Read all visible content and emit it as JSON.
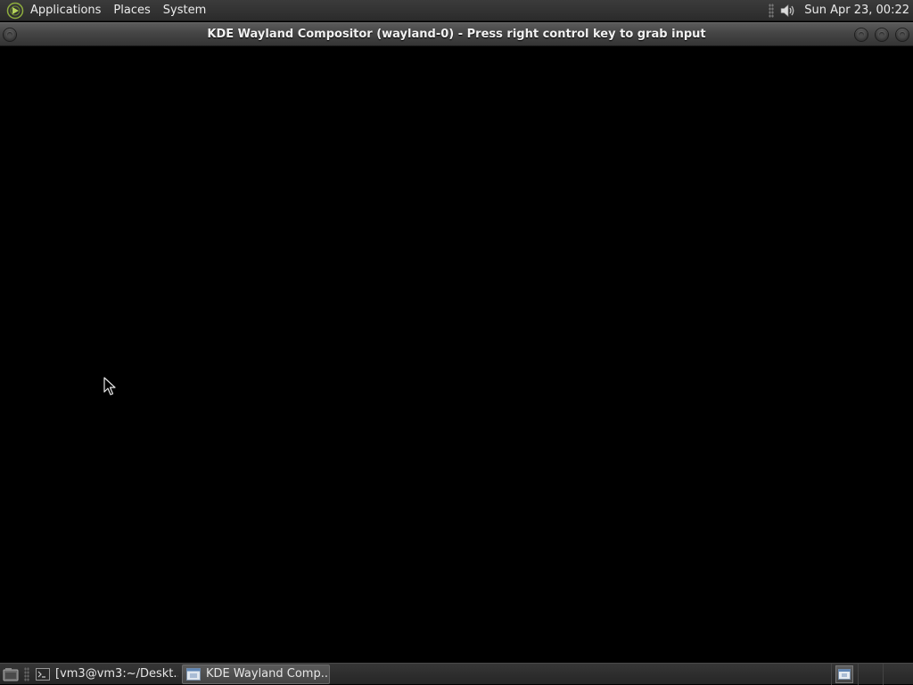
{
  "top_panel": {
    "menus": [
      "Applications",
      "Places",
      "System"
    ],
    "clock": "Sun Apr 23, 00:22",
    "icons": {
      "logo": "distro-logo-icon",
      "volume": "speaker-icon"
    }
  },
  "window": {
    "title": "KDE Wayland Compositor (wayland-0) - Press right control key to grab input",
    "icons": {
      "menu": "window-menu-icon",
      "minimize": "minimize-icon",
      "maximize": "maximize-icon",
      "close": "close-icon"
    }
  },
  "taskbar": {
    "tasks": [
      {
        "label": "[vm3@vm3:~/Deskt...",
        "icon": "terminal-icon",
        "active": false
      },
      {
        "label": "KDE Wayland Comp...",
        "icon": "window-icon",
        "active": true
      }
    ],
    "icons": {
      "show_desktop": "show-desktop-icon",
      "tray": "workspace-switcher-icon"
    }
  },
  "colors": {
    "panel": "#2e2e2e",
    "titlebar": "#454545",
    "content": "#000000",
    "text": "#ececec"
  }
}
